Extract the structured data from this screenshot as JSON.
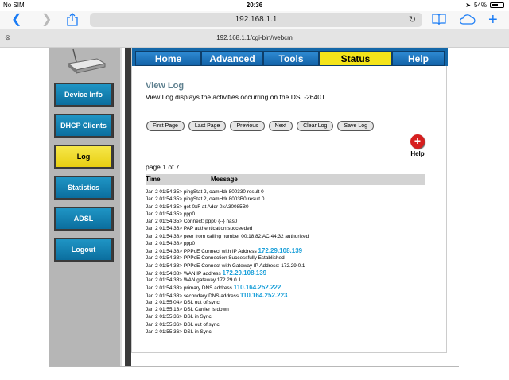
{
  "status_bar": {
    "carrier": "No SIM",
    "time": "20:36",
    "battery": "54%",
    "battery_level": 0.54
  },
  "browser": {
    "back_icon": "chevron-left-icon",
    "forward_icon": "chevron-right-icon",
    "share_icon": "share-icon",
    "address": "192.168.1.1",
    "tab_url": "192.168.1.1/cgi-bin/webcm",
    "reload_icon": "reload-icon",
    "bookmarks_icon": "book-icon",
    "cloud_icon": "cloud-icon",
    "new_tab_icon": "plus-icon",
    "close_tab_icon": "close-icon"
  },
  "top_tabs": [
    {
      "label": "Home"
    },
    {
      "label": "Advanced"
    },
    {
      "label": "Tools"
    },
    {
      "label": "Status",
      "active": true
    },
    {
      "label": "Help"
    }
  ],
  "side_nav": [
    {
      "label": "Device Info"
    },
    {
      "label": "DHCP Clients"
    },
    {
      "label": "Log",
      "active": true
    },
    {
      "label": "Statistics"
    },
    {
      "label": "ADSL"
    },
    {
      "label": "Logout"
    }
  ],
  "main": {
    "title": "View Log",
    "description": "View Log displays the activities occurring on the DSL-2640T .",
    "buttons": [
      "First Page",
      "Last Page",
      "Previous",
      "Next",
      "Clear Log",
      "Save Log"
    ],
    "help_label": "Help",
    "page_info": "page 1 of 7",
    "columns": {
      "time": "Time",
      "message": "Message"
    }
  },
  "log": [
    {
      "time": "Jan 2 01:54:35>",
      "msg": "pingStat 2, oamHdr 800330 result 0",
      "ip": ""
    },
    {
      "time": "Jan 2 01:54:35>",
      "msg": "pingStat 2, oamHdr 8003B0 result 0",
      "ip": ""
    },
    {
      "time": "Jan 2 01:54:35>",
      "msg": "get 0xF at Addr 0xA30085B0",
      "ip": ""
    },
    {
      "time": "Jan 2 01:54:35>",
      "msg": "ppp0",
      "ip": ""
    },
    {
      "time": "Jan 2 01:54:35>",
      "msg": "Connect: ppp0 {--} nas0",
      "ip": ""
    },
    {
      "time": "Jan 2 01:54:36>",
      "msg": "PAP authentication succeeded",
      "ip": ""
    },
    {
      "time": "Jan 2 01:54:38>",
      "msg": "peer from calling number 00:18:82:AC:44:32 authorized",
      "ip": ""
    },
    {
      "time": "Jan 2 01:54:38>",
      "msg": "ppp0",
      "ip": ""
    },
    {
      "time": "Jan 2 01:54:38>",
      "msg": "PPPoE Connect with IP Address",
      "ip": "172.29.108.139"
    },
    {
      "time": "Jan 2 01:54:38>",
      "msg": "PPPoE Connection Successfully Established",
      "ip": ""
    },
    {
      "time": "Jan 2 01:54:38>",
      "msg": "PPPoE Connect with Gateway IP Address: 172.29.0.1",
      "ip": ""
    },
    {
      "time": "Jan 2 01:54:38>",
      "msg": "WAN IP address",
      "ip": "172.29.108.139"
    },
    {
      "time": "Jan 2 01:54:38>",
      "msg": "WAN gateway 172.29.0.1",
      "ip": ""
    },
    {
      "time": "Jan 2 01:54:38>",
      "msg": "primary DNS address",
      "ip": "110.164.252.222"
    },
    {
      "time": "Jan 2 01:54:38>",
      "msg": "secondary DNS address",
      "ip": "110.164.252.223"
    },
    {
      "time": "Jan 2 01:55:04>",
      "msg": "DSL out of sync",
      "ip": ""
    },
    {
      "time": "Jan 2 01:55:13>",
      "msg": "DSL Carrier is down",
      "ip": ""
    },
    {
      "time": "Jan 2 01:55:36>",
      "msg": "DSL in Sync",
      "ip": ""
    },
    {
      "time": "Jan 2 01:55:36>",
      "msg": "DSL out of sync",
      "ip": ""
    },
    {
      "time": "Jan 2 01:55:36>",
      "msg": "DSL in Sync",
      "ip": ""
    }
  ]
}
